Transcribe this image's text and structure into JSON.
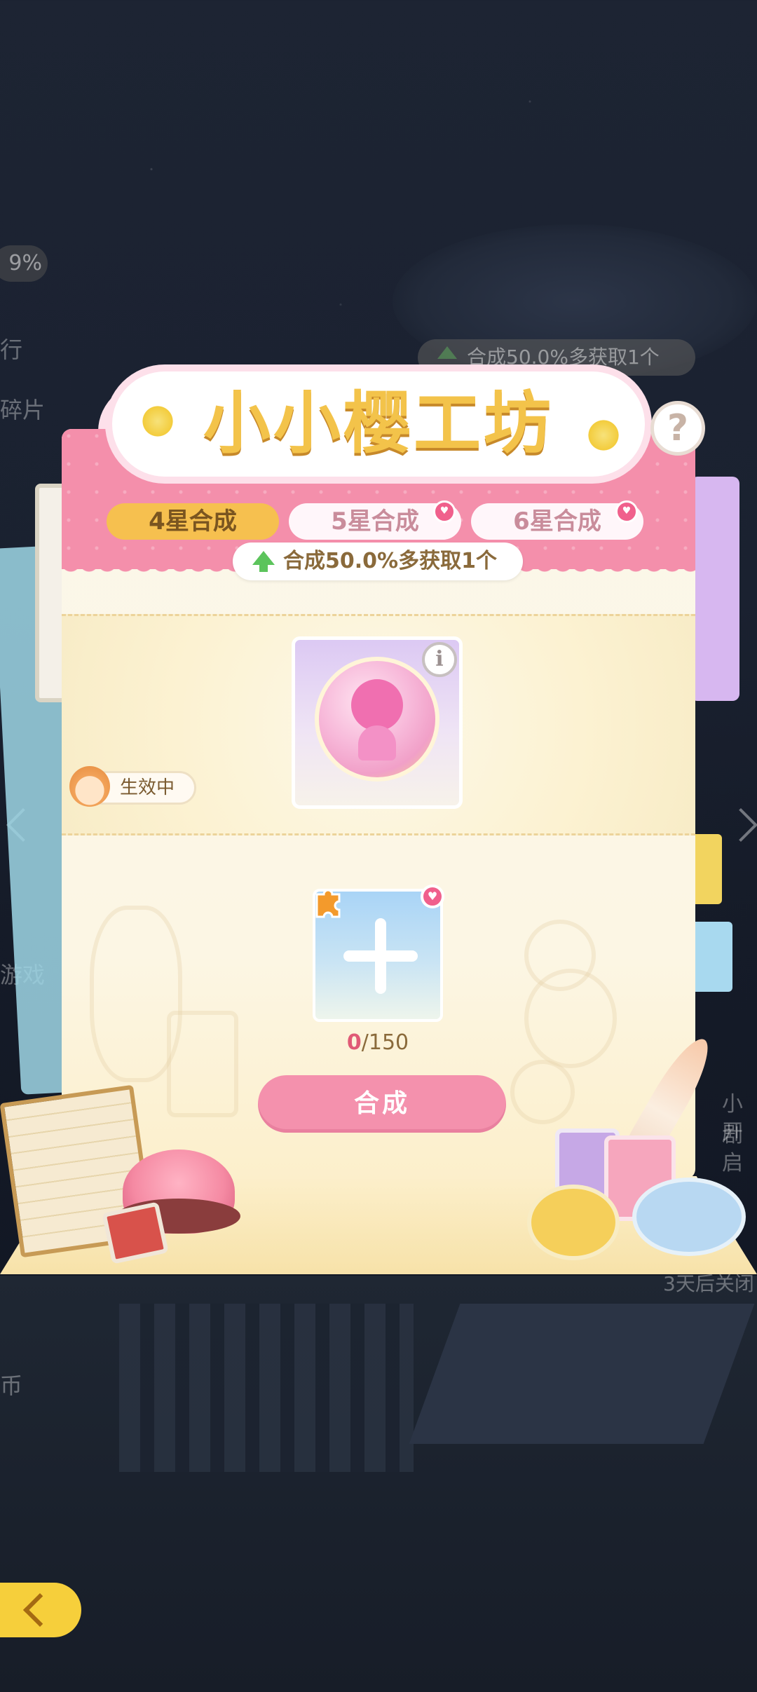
{
  "title": "小小樱工坊",
  "help_label": "?",
  "tabs": [
    {
      "label": "4星合成",
      "active": true,
      "badge": false
    },
    {
      "label": "5星合成",
      "active": false,
      "badge": true
    },
    {
      "label": "6星合成",
      "active": false,
      "badge": true
    }
  ],
  "bonus_text": "合成50.0%多获取1个",
  "result": {
    "info_label": "i",
    "active_label": "生效中"
  },
  "material": {
    "have": "0",
    "need": "/150"
  },
  "combine_label": "合成",
  "background": {
    "top_hint": "合成50.0%多获取1个",
    "left_pct": "9%",
    "left_texts": [
      "行",
      "碎片",
      "游戏",
      "币"
    ],
    "right_texts": [
      "小剧",
      "开启",
      "3天后关闭"
    ]
  },
  "colors": {
    "header_pink": "#f48fab",
    "active_tab": "#f6c04f",
    "combine_button": "#f491ad",
    "title_yellow": "#f3c34a"
  }
}
